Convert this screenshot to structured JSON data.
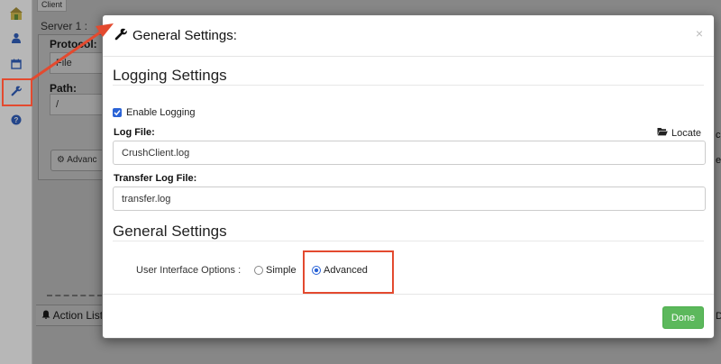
{
  "background": {
    "client_tab": "Client",
    "server_label": "Server 1 :",
    "protocol_label": "Protocol:",
    "protocol_value": "File",
    "path_label": "Path:",
    "path_value": "/",
    "advanced_button": "Advanc",
    "action_list_label": "Action List",
    "right_peek_1": "c",
    "right_peek_2": "el",
    "right_peek_3": "D"
  },
  "sidebar": {
    "icons": [
      "home-icon",
      "user-icon",
      "calendar-icon",
      "wrench-icon",
      "help-icon"
    ]
  },
  "modal": {
    "title": "General Settings:",
    "close": "×",
    "logging": {
      "section_title": "Logging Settings",
      "enable_label": "Enable Logging",
      "enable_checked": true,
      "log_file_label": "Log File:",
      "locate_label": "Locate",
      "log_file_value": "CrushClient.log",
      "transfer_log_label": "Transfer Log File:",
      "transfer_log_value": "transfer.log"
    },
    "general": {
      "section_title": "General Settings",
      "ui_options_label": "User Interface Options :",
      "options": [
        "Simple",
        "Advanced"
      ],
      "selected": "Advanced"
    },
    "done_label": "Done"
  },
  "colors": {
    "annotation": "#e34a2f",
    "primary": "#2a63d6",
    "success": "#5cb85c"
  }
}
